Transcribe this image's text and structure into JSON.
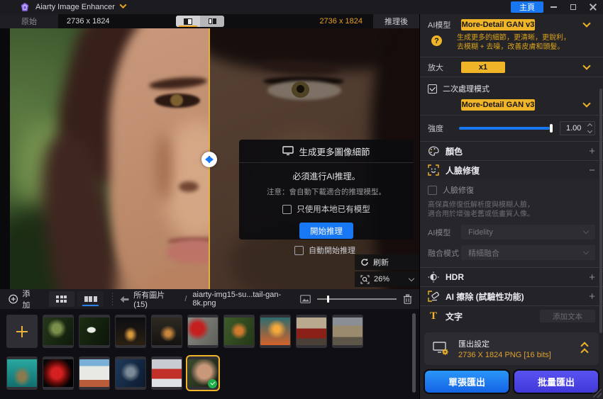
{
  "titlebar": {
    "app_title": "Aiarty Image Enhancer",
    "home_button": "主頁"
  },
  "viewer": {
    "original_tab": "原始",
    "original_size": "2736 x 1824",
    "enhanced_size": "2736 x 1824",
    "enhanced_tab": "推理後",
    "auto_start_label": "自動開始推理",
    "refresh_label": "刷新",
    "zoom_value": "26%"
  },
  "dialog": {
    "title": "生成更多圖像細節",
    "message": "必須進行AI推理。",
    "note": "注意：會自動下載適合的推理模型。",
    "local_model_checkbox": "只使用本地已有模型",
    "start_button": "開始推理"
  },
  "panel": {
    "ai_model_label": "AI模型",
    "ai_model_value": "More-Detail GAN  v3",
    "model_desc_line1": "生成更多的細節，更清晰，更銳利，",
    "model_desc_line2": "去模糊 + 去噪，改善皮膚和頭髮。",
    "scale_label": "放大",
    "scale_value": "x1",
    "secondary_checkbox": "二次處理模式",
    "secondary_model_value": "More-Detail GAN  v3",
    "strength_label": "強度",
    "strength_value": "1.00",
    "color_section": "顏色",
    "face_section": "人臉修復",
    "face_checkbox": "人臉修復",
    "face_desc_line1": "高保真修復低解析度與模糊人臉，",
    "face_desc_line2": "適合用於增強老舊或低畫質人像。",
    "face_model_label": "AI模型",
    "face_model_value": "Fidelity",
    "blend_label": "融合模式",
    "blend_value": "精細融合",
    "hdr_section": "HDR",
    "erase_section": "AI 擦除 (試驗性功能)",
    "text_section": "文字",
    "add_text_button": "添加文本",
    "export_title": "匯出設定",
    "export_detail": "2736 X 1824  PNG  [16 bits]",
    "export_single_button": "單張匯出",
    "export_batch_button": "批量匯出"
  },
  "filmstrip": {
    "add_label": "添加",
    "folder_label": "所有圖片 (15)",
    "separator": "/",
    "file_label": "aiarty-img15-su...tail-gan-8k.png"
  },
  "glyphs": {
    "expand": "+",
    "collapse": "−",
    "question": "?"
  },
  "colors": {
    "accent_yellow": "#f0b428",
    "accent_blue": "#1877f2",
    "accent_indigo": "#4b43e0"
  },
  "thumbnails": [
    {
      "name": "forest-plant",
      "bg": "radial-gradient(ellipse at 45% 40%, #7a8f4a 0 18%, transparent 42%), linear-gradient(120deg, #24371a, #0f1a0b)"
    },
    {
      "name": "white-egret",
      "bg": "radial-gradient(ellipse 9px 6px at 40% 45%, #e8ece4 0 60%, transparent 75%), linear-gradient(120deg, #1c2e12, #0c150a)"
    },
    {
      "name": "city-night",
      "bg": "radial-gradient(ellipse at 50% 62%, #d89a3c 0 9%, transparent 32%), linear-gradient(180deg, #0d0d12, #2a1f12)"
    },
    {
      "name": "lake-house",
      "bg": "radial-gradient(ellipse at 55% 58%, #c8863c 0 11%, transparent 36%), linear-gradient(180deg, #2e2a22, #141210)"
    },
    {
      "name": "red-flower-hummingbird",
      "bg": "radial-gradient(circle at 32% 40%, #c42020 0 22%, transparent 46%), linear-gradient(120deg, #8a8d85, #5d5f58)"
    },
    {
      "name": "person-with-camera",
      "bg": "radial-gradient(circle at 50% 48%, #d07a2e 0 16%, transparent 42%), linear-gradient(120deg, #3e5c2a, #243716)"
    },
    {
      "name": "sunset-lake",
      "bg": "radial-gradient(circle at 55% 42%, #f5a93c 0 13%, transparent 42%), linear-gradient(180deg, #2e6b6e, #d4622a)"
    },
    {
      "name": "red-classic-car",
      "bg": "linear-gradient(180deg, #b9a98e 0 40%, #8a2018 40% 75%, #4a4038 75%)"
    },
    {
      "name": "village-street",
      "bg": "linear-gradient(180deg, #8a8f96 0 30%, #9a8a6e 30% 70%, #5c5548 70%)"
    },
    {
      "name": "underwater-turtle",
      "bg": "radial-gradient(ellipse at 50% 62%, #8a7a4e 0 16%, transparent 42%), linear-gradient(180deg, #2aa8a0, #116e6e)"
    },
    {
      "name": "red-betta-fish",
      "bg": "radial-gradient(circle at 45% 50%, #d42020 0 24%, #5e0a08 50%, transparent 72%), linear-gradient(120deg, #0a0a0a, #000)"
    },
    {
      "name": "white-building-flowers",
      "bg": "linear-gradient(180deg, #7ab0d8 0 25%, #e8e8e4 25% 75%, #b85c3a 75%)"
    },
    {
      "name": "dog-graffiti",
      "bg": "radial-gradient(circle at 50% 46%, #7a8a96 0 18%, transparent 46%), linear-gradient(120deg, #1e3a5c, #0c1a2e)"
    },
    {
      "name": "red-train-snow",
      "bg": "linear-gradient(180deg, #c8ccd2 0 35%, #c03028 35% 70%, #dfe2e6 70%)"
    },
    {
      "name": "woman-portrait",
      "selected": true,
      "bg": "radial-gradient(circle at 55% 45%, #c9987a 0 30%, transparent 62%), linear-gradient(120deg, #3a4a2e, #1a2012)"
    }
  ]
}
